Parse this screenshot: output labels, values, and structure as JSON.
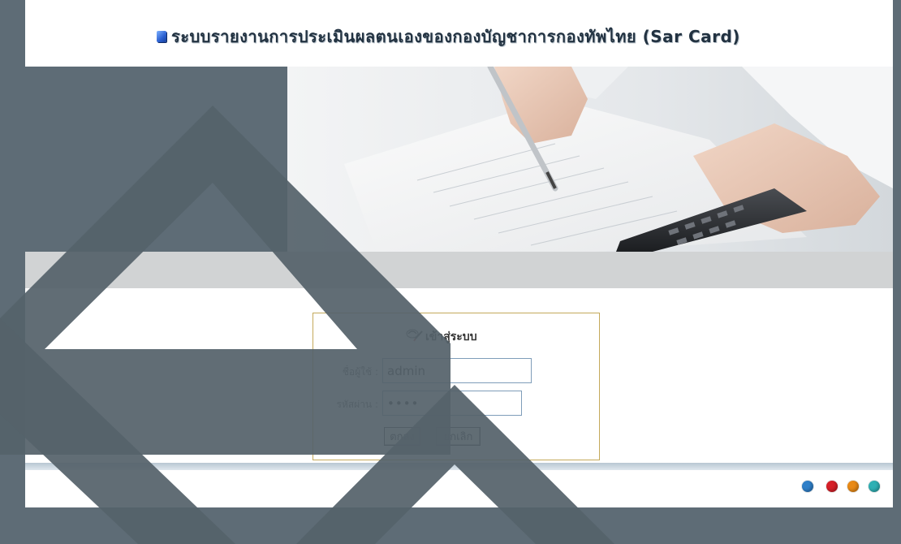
{
  "header": {
    "title": "ระบบรายงานการประเมินผลตนเองของกองบัญชาการกองทัพไทย (Sar Card)"
  },
  "login": {
    "title": "เข้าสู่ระบบ",
    "username_label": "ชื่อผู้ใช้ :",
    "username_value": "admin",
    "password_label": "รหัสผ่าน :",
    "password_value": "••••",
    "ok_button": "ตกลง",
    "cancel_button": "ยกเลิก"
  },
  "footer": {
    "dots": [
      "#2f7fc8",
      "#d62028",
      "#e98a16",
      "#2fb0b4"
    ]
  },
  "colors": {
    "frame": "#5e6c76",
    "login_border": "#c4a95a",
    "strip": "#d1d3d4"
  },
  "icons": [
    "bullet-icon",
    "login-icon"
  ]
}
